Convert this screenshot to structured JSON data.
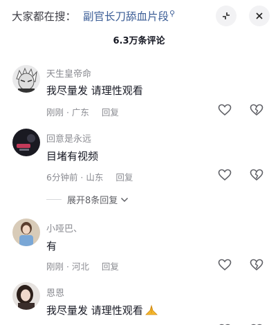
{
  "header": {
    "search_prefix": "大家都在搜：",
    "search_term": "副官长刀舔血片段",
    "search_icon": "search-icon",
    "shrink_icon": "collapse-window-icon",
    "close_icon": "close-icon"
  },
  "comment_count": "6.3万条评论",
  "comments": [
    {
      "username": "天生皇帝命",
      "text": "我尽量发 请理性观看",
      "time": "刚刚 · 广东",
      "reply": "回复"
    },
    {
      "username": "回意是永远",
      "text": "目堵有视频",
      "time": "6分钟前 · 山东",
      "reply": "回复",
      "expand": "展开8条回复"
    },
    {
      "username": "小哑巴、",
      "text": "有",
      "time": "刚刚 · 河北",
      "reply": "回复"
    },
    {
      "username": "恩恩",
      "text": "我尽量发  请理性观看",
      "emoji": "praying-hands-emoji"
    }
  ],
  "colors": {
    "link_blue": "#3b5d96",
    "secondary_text": "#8a8b91",
    "primary_text": "#161823"
  }
}
